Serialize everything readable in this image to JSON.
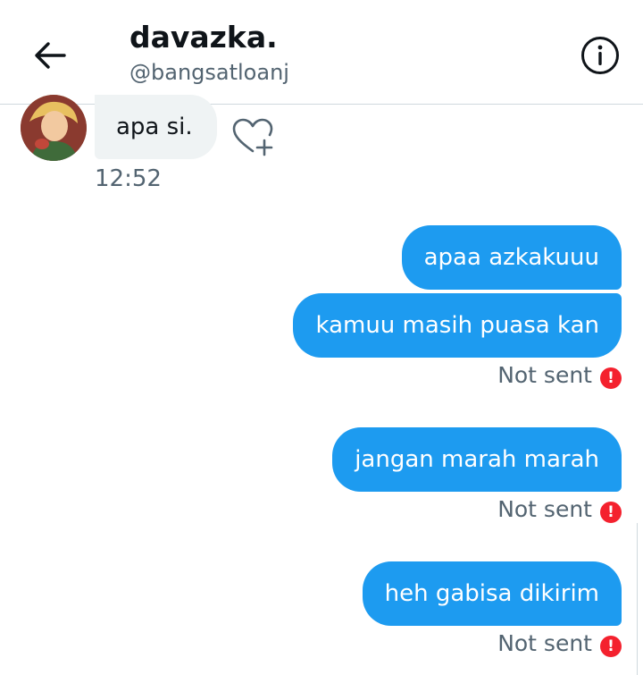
{
  "header": {
    "display_name": "davazka.",
    "handle": "@bangsatloanj",
    "back_icon": "arrow-left-icon",
    "info_icon": "info-circle-icon"
  },
  "received": {
    "text": "apa si.",
    "time": "12:52",
    "react_icon": "heart-plus-icon"
  },
  "sent": [
    {
      "text": "apaa azkakuuu"
    },
    {
      "text": "kamuu masih puasa kan",
      "status": "Not sent"
    },
    {
      "text": "jangan marah marah",
      "status": "Not sent"
    },
    {
      "text": "heh gabisa dikirim",
      "status": "Not sent"
    }
  ],
  "error_glyph": "!",
  "colors": {
    "accent": "#1d9bf0",
    "received_bubble": "#eff3f4",
    "error": "#f4212e",
    "secondary_text": "#536471"
  }
}
